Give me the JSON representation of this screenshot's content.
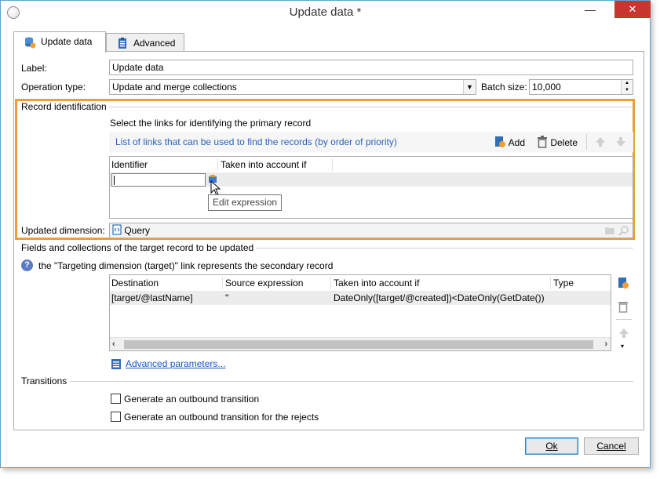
{
  "window": {
    "title": "Update data *",
    "minimize": "—",
    "maximize": "▢",
    "close": "✕"
  },
  "tabs": [
    {
      "label": "Update data",
      "icon": "database-icon"
    },
    {
      "label": "Advanced",
      "icon": "clipboard-icon"
    }
  ],
  "form": {
    "label_label": "Label:",
    "label_value": "Update data",
    "operation_label": "Operation type:",
    "operation_value": "Update and merge collections",
    "batch_label": "Batch size:",
    "batch_value": "10,000"
  },
  "record_identification": {
    "section_title": "Record identification",
    "instruction": "Select the links for identifying the primary record",
    "list_caption": "List of links that can be used to find the records (by order of priority)",
    "add_label": "Add",
    "delete_label": "Delete",
    "columns": [
      "Identifier",
      "Taken into account if"
    ],
    "tooltip": "Edit expression",
    "updated_dimension_label": "Updated dimension:",
    "updated_dimension_value": "Query"
  },
  "fields_section": {
    "section_title": "Fields and collections of the target record to be updated",
    "info_text": "the \"Targeting dimension (target)\" link represents the secondary record",
    "columns": [
      "Destination",
      "Source expression",
      "Taken into account if",
      "Type"
    ],
    "rows": [
      {
        "destination": "[target/@lastName]",
        "source": "''",
        "condition": "DateOnly([target/@created])<DateOnly(GetDate())",
        "type": ""
      }
    ],
    "advanced_link": "Advanced parameters..."
  },
  "transitions": {
    "section_title": "Transitions",
    "options": [
      {
        "label": "Generate an outbound transition",
        "checked": false
      },
      {
        "label": "Generate an outbound transition for the rejects",
        "checked": false
      }
    ]
  },
  "footer": {
    "ok_label": "Ok",
    "cancel_label": "Cancel"
  },
  "colors": {
    "highlight_border": "#f39c34",
    "close_button": "#c7372f",
    "link": "#1a55c8"
  }
}
